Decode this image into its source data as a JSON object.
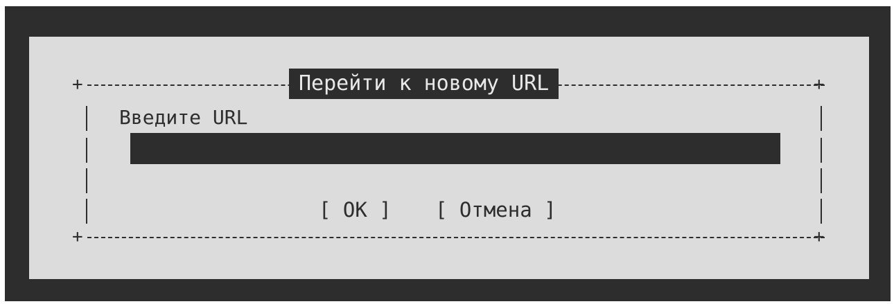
{
  "dialog": {
    "title": "Перейти к новому URL",
    "prompt_label": "Введите URL",
    "url_value": "",
    "ok_button": "[ OK ]",
    "cancel_button": "[ Отмена ]"
  },
  "theme": {
    "background": "#2d2d2d",
    "dialog_background": "#dcdcdc",
    "text": "#2d2d2d"
  }
}
